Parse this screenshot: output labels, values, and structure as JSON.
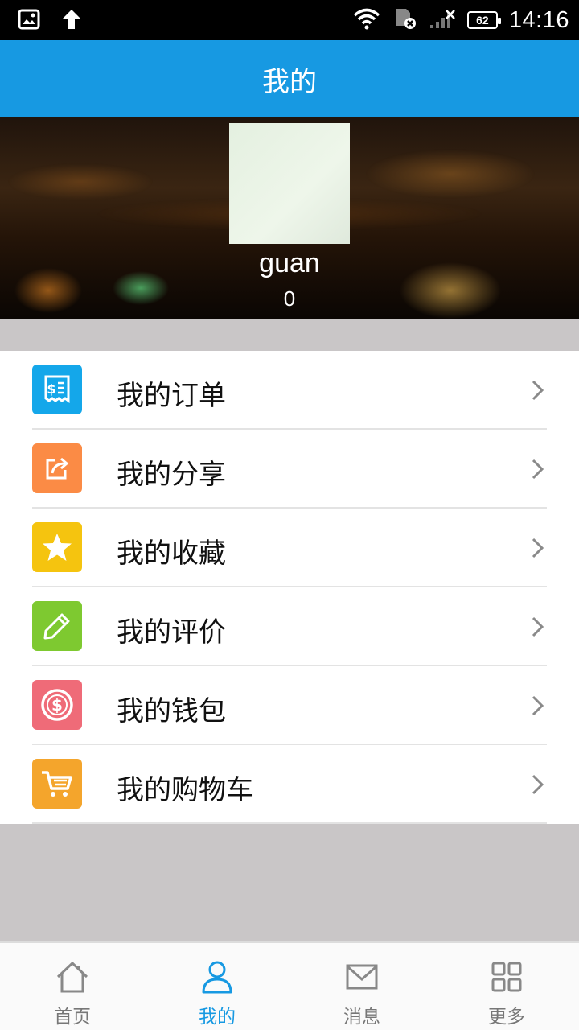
{
  "status_bar": {
    "time": "14:16",
    "battery": "62",
    "icons": [
      "gallery-notification-icon",
      "upload-arrow-icon",
      "wifi-icon",
      "sim-error-icon",
      "signal-icon",
      "battery-icon"
    ]
  },
  "header": {
    "title": "我的"
  },
  "profile": {
    "username": "guan",
    "points": "0"
  },
  "menu": {
    "items": [
      {
        "label": "我的订单",
        "icon": "receipt-icon",
        "color": "#14a7ea"
      },
      {
        "label": "我的分享",
        "icon": "share-icon",
        "color": "#fb8b45"
      },
      {
        "label": "我的收藏",
        "icon": "star-icon",
        "color": "#f5c40f"
      },
      {
        "label": "我的评价",
        "icon": "pencil-icon",
        "color": "#7ec930"
      },
      {
        "label": "我的钱包",
        "icon": "wallet-dollar-icon",
        "color": "#ef6b78"
      },
      {
        "label": "我的购物车",
        "icon": "cart-icon",
        "color": "#f4a52c"
      }
    ]
  },
  "bottom_nav": {
    "items": [
      {
        "label": "首页",
        "icon": "home-icon",
        "active": false
      },
      {
        "label": "我的",
        "icon": "user-icon",
        "active": true
      },
      {
        "label": "消息",
        "icon": "mail-icon",
        "active": false
      },
      {
        "label": "更多",
        "icon": "grid-icon",
        "active": false
      }
    ]
  },
  "colors": {
    "primary": "#1799e2",
    "background": "#c9c6c7",
    "inactive_nav": "#777777"
  }
}
